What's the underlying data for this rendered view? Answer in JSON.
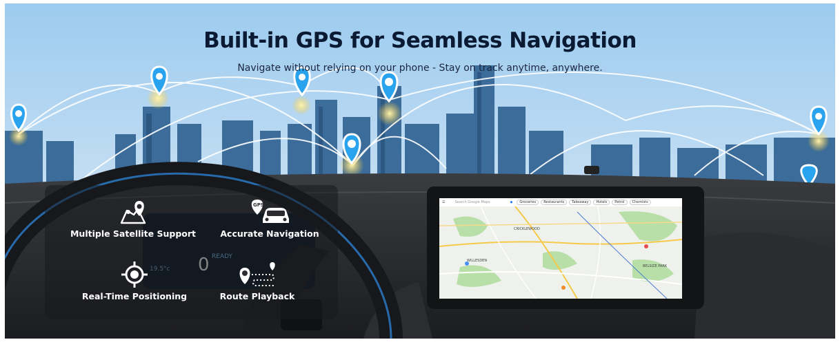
{
  "banner": {
    "title": "Built-in GPS for Seamless Navigation",
    "subtitle": "Navigate without relying on your phone - Stay on track anytime, anywhere."
  },
  "features": [
    {
      "label": "Multiple Satellite Support",
      "icon": "map-pin-route-icon"
    },
    {
      "label": "Accurate Navigation",
      "icon": "gps-car-icon"
    },
    {
      "label": "Real-Time Positioning",
      "icon": "crosshair-target-icon"
    },
    {
      "label": "Route Playback",
      "icon": "route-path-icon"
    }
  ],
  "dashboard": {
    "speed": "0",
    "status": "READY",
    "temperature": "19.5°c"
  },
  "map": {
    "search_placeholder": "Search Google Maps",
    "chips": [
      "Groceries",
      "Restaurants",
      "Takeaway",
      "Hotels",
      "Petrol",
      "Chemists"
    ],
    "places": [
      "CRICKLEWOOD",
      "WILLESDEN",
      "BELSIZE PARK"
    ]
  },
  "colors": {
    "headline": "#0b1a33",
    "pin": "#2aa3ee",
    "sky_top": "#8cc4ee",
    "map_park": "#b9dfa9",
    "map_road": "#f5c94a"
  }
}
